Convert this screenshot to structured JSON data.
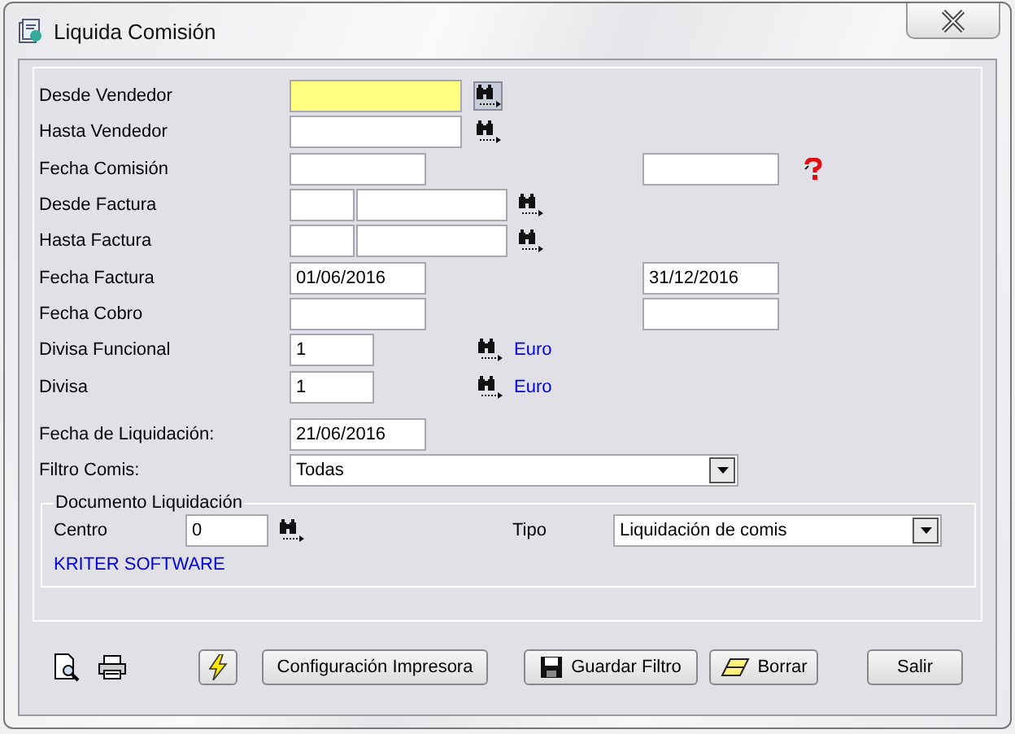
{
  "window": {
    "title": "Liquida Comisión"
  },
  "fields": [
    {
      "kind": "vendor",
      "label": "Desde Vendedor",
      "focused": true
    },
    {
      "kind": "vendor",
      "label": "Hasta Vendedor",
      "focused": false
    },
    {
      "kind": "range",
      "label": "Fecha Comisión",
      "help": true
    },
    {
      "kind": "invoice",
      "label": "Desde Factura"
    },
    {
      "kind": "invoice",
      "label": "Hasta Factura"
    },
    {
      "kind": "range",
      "label": "Fecha Factura",
      "from": "01/06/2016",
      "to": "31/12/2016",
      "help": false
    },
    {
      "kind": "range",
      "label": "Fecha Cobro",
      "help": false
    },
    {
      "kind": "currency",
      "label": "Divisa Funcional",
      "value": "1",
      "link": "Euro"
    },
    {
      "kind": "currency",
      "label": "Divisa",
      "value": "1",
      "link": "Euro"
    }
  ],
  "settlement_fields": [
    {
      "kind": "date",
      "label": "Fecha de Liquidación:",
      "value": "21/06/2016"
    },
    {
      "kind": "select",
      "label": "Filtro Comis:",
      "value": "Todas"
    }
  ],
  "document": {
    "legend": "Documento Liquidación",
    "centro_label": "Centro",
    "centro_value": "0",
    "tipo_label": "Tipo",
    "tipo_value": "Liquidación de comis",
    "company": "KRITER SOFTWARE"
  },
  "buttons": [
    {
      "kind": "preview"
    },
    {
      "kind": "print"
    },
    {
      "kind": "run"
    },
    {
      "kind": "text",
      "label": "Configuración Impresora"
    },
    {
      "kind": "save",
      "label": "Guardar Filtro"
    },
    {
      "kind": "erase",
      "label": "Borrar"
    },
    {
      "kind": "exit",
      "label": "Salir"
    }
  ]
}
